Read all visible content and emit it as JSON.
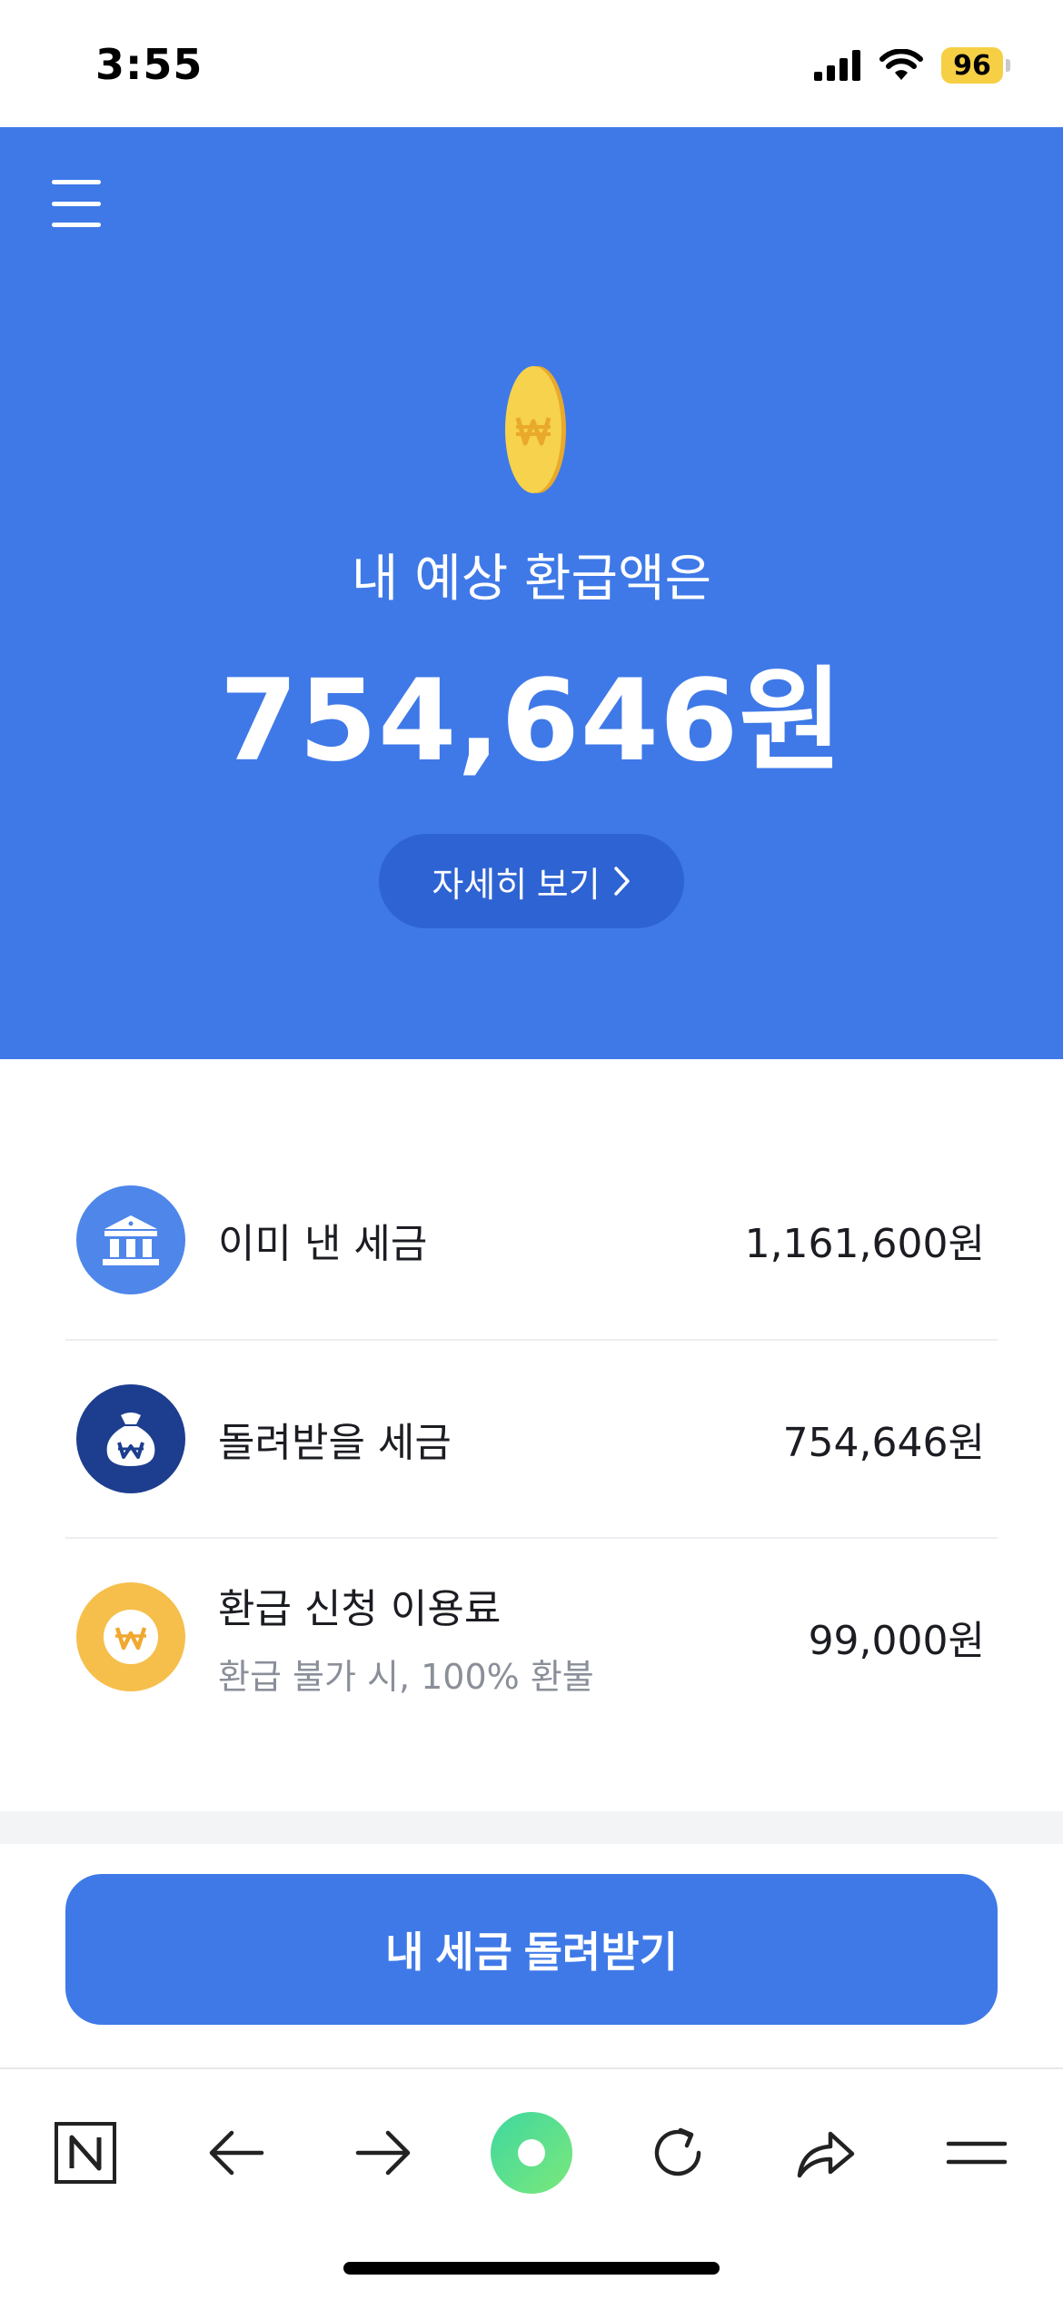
{
  "status_bar": {
    "time": "3:55",
    "battery": "96",
    "icons": [
      "signal-icon",
      "wifi-icon",
      "battery-icon"
    ]
  },
  "hero": {
    "menu_icon": "hamburger-menu-icon",
    "coin_icon": "won-coin-icon",
    "label": "내 예상 환급액은",
    "amount": "754,646원",
    "detail_button": "자세히 보기"
  },
  "rows": [
    {
      "icon": "bank-icon",
      "title": "이미 낸 세금",
      "subtitle": "",
      "value": "1,161,600원",
      "icon_color": "#4f86ea"
    },
    {
      "icon": "money-bag-icon",
      "title": "돌려받을 세금",
      "subtitle": "",
      "value": "754,646원",
      "icon_color": "#1d3e8f"
    },
    {
      "icon": "won-coin-icon",
      "title": "환급 신청 이용료",
      "subtitle": "환급 불가 시, 100% 환불",
      "value": "99,000원",
      "icon_color": "#f6bf4c"
    }
  ],
  "cta": {
    "label": "내 세금 돌려받기"
  },
  "browser_toolbar": {
    "items": [
      "naver-icon",
      "back-arrow-icon",
      "forward-arrow-icon",
      "green-dot-icon",
      "reload-icon",
      "share-icon",
      "menu-icon"
    ]
  },
  "colors": {
    "primary": "#3f79e8",
    "pill": "#2e63d3",
    "battery": "#f6cf45",
    "coin": "#f7d24c"
  }
}
